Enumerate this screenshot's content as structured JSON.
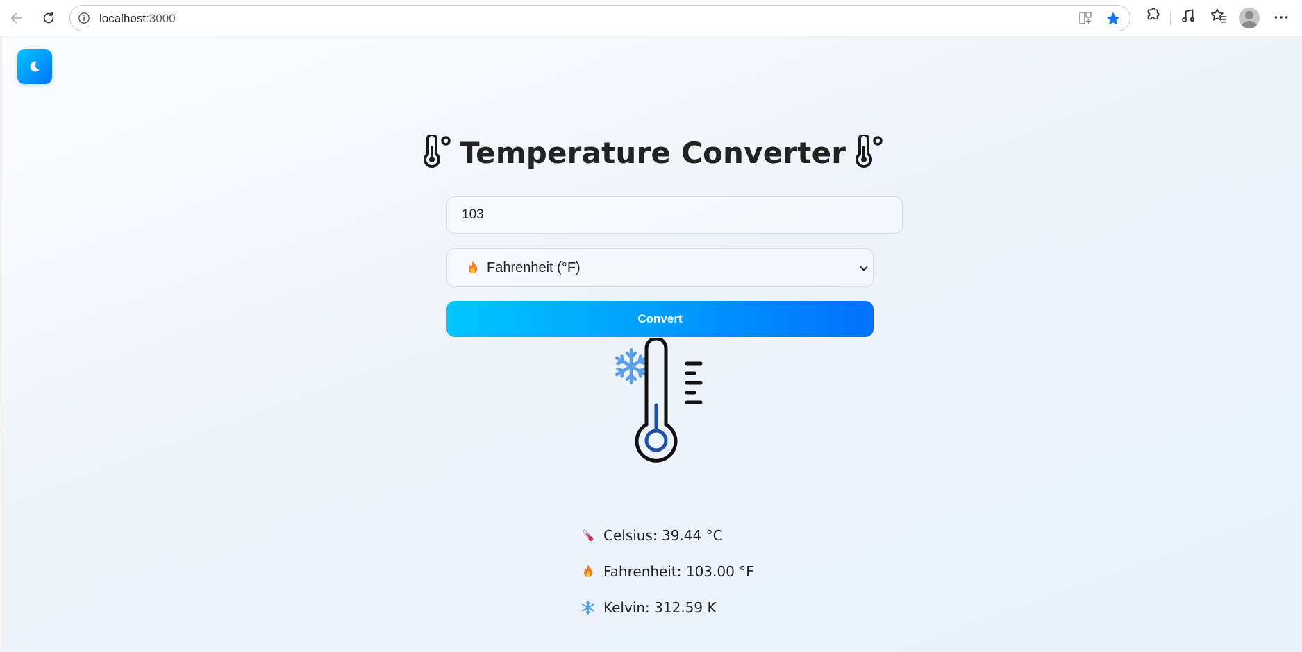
{
  "browser": {
    "url_host": "localhost",
    "url_port": ":3000"
  },
  "icons": {
    "back": "back-arrow-icon",
    "reload": "reload-icon",
    "info": "info-icon",
    "theme": "moon-icon",
    "title": "thermometer-icon",
    "celsius": "thermometer-icon",
    "fahrenheit": "fire-icon",
    "kelvin": "snowflake-icon"
  },
  "colors": {
    "accent_start": "#00c6ff",
    "accent_end": "#0072ff",
    "mercury": "#1e4fa8",
    "snowflake": "#5b9ee8"
  },
  "app": {
    "title": "Temperature Converter",
    "input_value": "103",
    "unit_selected": "Fahrenheit (°F)",
    "convert_label": "Convert"
  },
  "results": {
    "celsius": "Celsius: 39.44 °C",
    "fahrenheit": "Fahrenheit: 103.00 °F",
    "kelvin": "Kelvin: 312.59 K"
  }
}
